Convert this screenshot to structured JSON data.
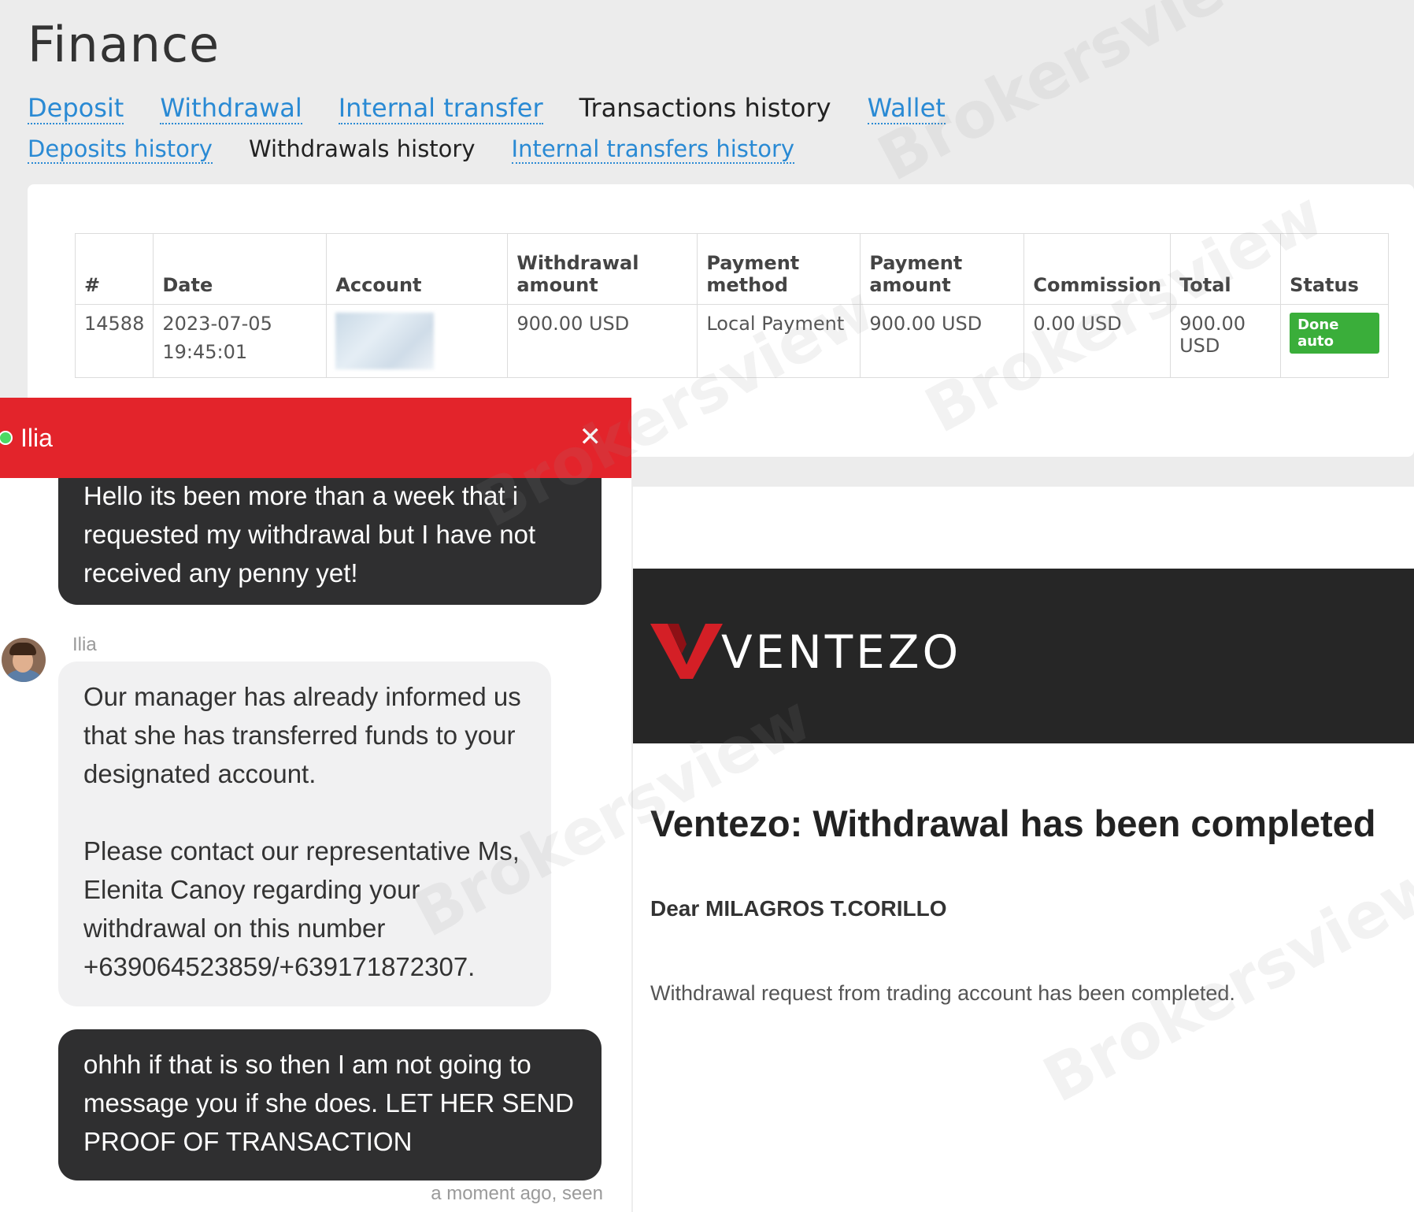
{
  "finance": {
    "title": "Finance",
    "tabs": [
      {
        "label": "Deposit",
        "active": false
      },
      {
        "label": "Withdrawal",
        "active": false
      },
      {
        "label": "Internal transfer",
        "active": false
      },
      {
        "label": "Transactions history",
        "active": true
      },
      {
        "label": "Wallet",
        "active": false
      }
    ],
    "subtabs": [
      {
        "label": "Deposits history",
        "active": false
      },
      {
        "label": "Withdrawals history",
        "active": true
      },
      {
        "label": "Internal transfers history",
        "active": false
      }
    ],
    "table": {
      "headers": [
        "#",
        "Date",
        "Account",
        "Withdrawal amount",
        "Payment method",
        "Payment amount",
        "Commission",
        "Total",
        "Status"
      ],
      "row": {
        "id": "14588",
        "date": "2023-07-05",
        "time": "19:45:01",
        "account": "",
        "withdrawal_amount": "900.00 USD",
        "payment_method": "Local Payment",
        "payment_amount": "900.00 USD",
        "commission": "0.00 USD",
        "total": "900.00 USD",
        "status": "Done auto"
      }
    }
  },
  "chat": {
    "header_name": "Ilia",
    "messages": [
      {
        "from": "user",
        "text": "Hello its been more than a week that i requested my withdrawal but I have not received any penny yet!"
      },
      {
        "from": "agent",
        "sender": "Ilia",
        "text_p1": "Our manager has already informed us that she has transferred funds to your designated account.",
        "text_p2": "Please contact our representative Ms, Elenita Canoy regarding your withdrawal on this number +639064523859/+639171872307."
      },
      {
        "from": "user",
        "text": "ohhh if that is so then I am not going to message you if she does. LET HER SEND PROOF OF TRANSACTION"
      }
    ],
    "seen_status": "a moment ago, seen"
  },
  "email": {
    "brand": "VENTEZO",
    "heading": "Ventezo: Withdrawal has been completed",
    "greeting": "Dear MILAGROS T.CORILLO",
    "body": "Withdrawal request from trading account has been completed."
  },
  "colors": {
    "link": "#2a8ad4",
    "chat_header": "#e3242b",
    "bubble_dark": "#2f2f30",
    "bubble_light": "#f1f1f2",
    "status_green": "#3aae3a",
    "brand_red": "#d41f26"
  },
  "watermark": "Brokersview"
}
